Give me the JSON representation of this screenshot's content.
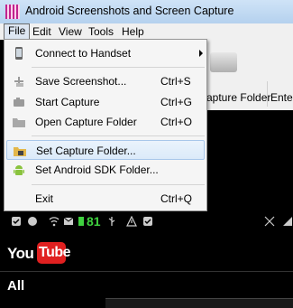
{
  "window": {
    "title": "Android Screenshots and Screen Capture"
  },
  "menubar": {
    "items": [
      "File",
      "Edit",
      "View",
      "Tools",
      "Help"
    ]
  },
  "file_menu": {
    "items": [
      {
        "label": "Connect to Handset",
        "shortcut": "",
        "icon": "phone-icon",
        "submenu": true
      },
      {
        "label": "Save Screenshot...",
        "shortcut": "Ctrl+S",
        "icon": "save-icon"
      },
      {
        "label": "Start Capture",
        "shortcut": "Ctrl+G",
        "icon": "camera-icon"
      },
      {
        "label": "Open Capture Folder",
        "shortcut": "Ctrl+O",
        "icon": "folder-icon"
      },
      {
        "label": "Set Capture Folder...",
        "shortcut": "",
        "icon": "folder-set-icon",
        "highlighted": true
      },
      {
        "label": "Set Android SDK Folder...",
        "shortcut": "",
        "icon": "android-icon"
      },
      {
        "label": "Exit",
        "shortcut": "Ctrl+Q",
        "icon": ""
      }
    ]
  },
  "toolbar": {
    "capture_folder_label": "apture Folder",
    "next_label": "Ente"
  },
  "phone": {
    "battery_text": "81",
    "youtube": {
      "you": "You",
      "tube": "Tube"
    },
    "tab_label": "All"
  },
  "colors": {
    "highlight": "#dbeaf9",
    "battery_green": "#3fd13f",
    "youtube_red": "#e02020"
  }
}
